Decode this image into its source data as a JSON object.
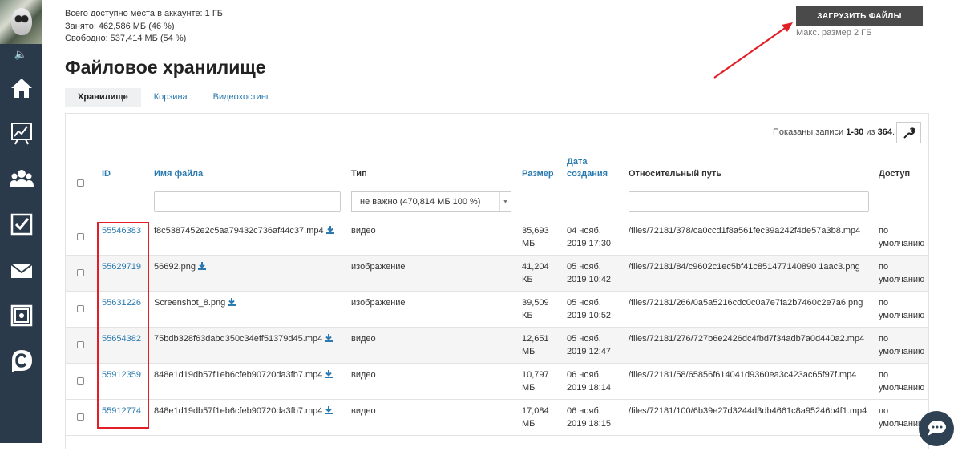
{
  "quota": {
    "total": "Всего доступно места в аккаунте: 1 ГБ",
    "used": "Занято: 462,586 МБ (46 %)",
    "free": "Свободно: 537,414 МБ (54 %)"
  },
  "upload": {
    "button_label": "ЗАГРУЗИТЬ ФАЙЛЫ",
    "max_size": "Макс. размер 2 ГБ"
  },
  "page_title": "Файловое хранилище",
  "tabs": [
    {
      "label": "Хранилище",
      "active": true
    },
    {
      "label": "Корзина",
      "active": false
    },
    {
      "label": "Видеохостинг",
      "active": false
    }
  ],
  "records": {
    "prefix": "Показаны записи ",
    "range": "1-30",
    "middle": " из ",
    "total": "364",
    "suffix": "."
  },
  "columns": {
    "id": "ID",
    "name": "Имя файла",
    "type": "Тип",
    "size": "Размер",
    "date_line1": "Дата",
    "date_line2": "создания",
    "path": "Относительный путь",
    "access": "Доступ"
  },
  "filters": {
    "type_selected": "не важно (470,814 МБ 100 %)"
  },
  "rows": [
    {
      "id": "55546383",
      "name": "f8c5387452e2c5aa79432c736af44c37.mp4",
      "type": "видео",
      "size_num": "35,693",
      "size_unit": "МБ",
      "date": "04 нояб.",
      "time": "2019 17:30",
      "path": "/files/72181/378/ca0ccd1f8a561fec39a242f4de57a3b8.mp4",
      "access1": "по",
      "access2": "умолчанию"
    },
    {
      "id": "55629719",
      "name": "56692.png",
      "type": "изображение",
      "size_num": "41,204",
      "size_unit": "КБ",
      "date": "05 нояб.",
      "time": "2019 10:42",
      "path": "/files/72181/84/c9602c1ec5bf41c851477140890 1aac3.png",
      "access1": "по",
      "access2": "умолчанию"
    },
    {
      "id": "55631226",
      "name": "Screenshot_8.png",
      "type": "изображение",
      "size_num": "39,509",
      "size_unit": "КБ",
      "date": "05 нояб.",
      "time": "2019 10:52",
      "path": "/files/72181/266/0a5a5216cdc0c0a7e7fa2b7460c2e7a6.png",
      "access1": "по",
      "access2": "умолчанию"
    },
    {
      "id": "55654382",
      "name": "75bdb328f63dabd350c34eff51379d45.mp4",
      "type": "видео",
      "size_num": "12,651",
      "size_unit": "МБ",
      "date": "05 нояб.",
      "time": "2019 12:47",
      "path": "/files/72181/276/727b6e2426dc4fbd7f34adb7a0d440a2.mp4",
      "access1": "по",
      "access2": "умолчанию"
    },
    {
      "id": "55912359",
      "name": "848e1d19db57f1eb6cfeb90720da3fb7.mp4",
      "type": "видео",
      "size_num": "10,797",
      "size_unit": "МБ",
      "date": "06 нояб.",
      "time": "2019 18:14",
      "path": "/files/72181/58/65856f614041d9360ea3c423ac65f97f.mp4",
      "access1": "по",
      "access2": "умолчанию"
    },
    {
      "id": "55912774",
      "name": "848e1d19db57f1eb6cfeb90720da3fb7.mp4",
      "type": "видео",
      "size_num": "17,084",
      "size_unit": "МБ",
      "date": "06 нояб.",
      "time": "2019 18:15",
      "path": "/files/72181/100/6b39e27d3244d3db4661c8a95246b4f1.mp4",
      "access1": "по",
      "access2": "умолчанию"
    }
  ],
  "colors": {
    "sidebar": "#2b3a4a",
    "link": "#2a7ab0",
    "highlight": "#e21f26",
    "upload_button": "#4a4a4a"
  }
}
